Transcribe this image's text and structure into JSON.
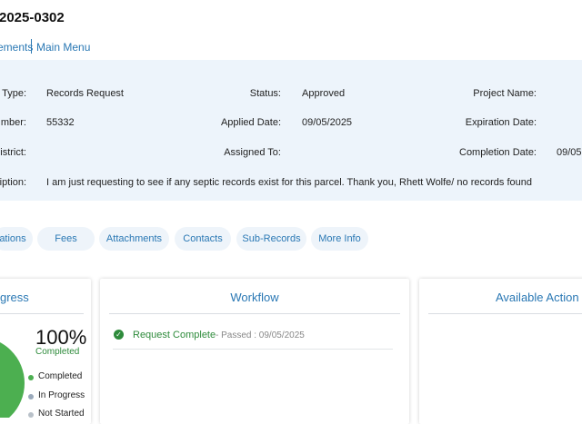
{
  "header": {
    "record_id": "-2025-0302",
    "nav": [
      "ements",
      "Main Menu"
    ]
  },
  "details": {
    "type_label": "Type:",
    "type_value": "Records Request",
    "status_label": "Status:",
    "status_value": "Approved",
    "project_label": "Project Name:",
    "project_value": "",
    "number_label": "mber:",
    "number_value": "55332",
    "applied_label": "Applied Date:",
    "applied_value": "09/05/2025",
    "expiration_label": "Expiration Date:",
    "expiration_value": "",
    "district_label": "istrict:",
    "district_value": "",
    "assigned_label": "Assigned To:",
    "assigned_value": "",
    "completion_label": "Completion Date:",
    "completion_value": "09/05",
    "description_label": "iption:",
    "description_value": "I am just requesting to see if any septic records exist for this parcel. Thank you, Rhett Wolfe/ no records found"
  },
  "tabs": [
    "ations",
    "Fees",
    "Attachments",
    "Contacts",
    "Sub-Records",
    "More Info"
  ],
  "progress": {
    "title": "gress",
    "percent_label": "100%",
    "percent_value": 100,
    "status_text": "Completed",
    "legend": [
      {
        "label": "Completed",
        "color": "#4caf50"
      },
      {
        "label": "In Progress",
        "color": "#9aa9bb"
      },
      {
        "label": "Not Started",
        "color": "#b9c1c9"
      }
    ]
  },
  "workflow": {
    "title": "Workflow",
    "items": [
      {
        "name": "Request Complete",
        "status": "- Passed : 09/05/2025"
      }
    ]
  },
  "actions": {
    "title": "Available Action"
  },
  "colors": {
    "link": "#2a78b4",
    "panel": "#edf4fb",
    "success": "#2e8b3b",
    "chart_green": "#4caf50"
  }
}
